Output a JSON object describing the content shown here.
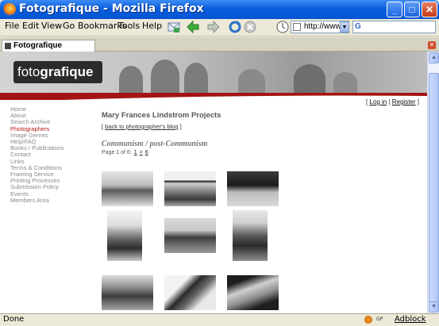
{
  "window": {
    "title": "Fotografique - Mozilla Firefox"
  },
  "menu": [
    "File",
    "Edit",
    "View",
    "Go",
    "Bookmarks",
    "Tools",
    "Help"
  ],
  "toolbar": {
    "url": "http://www"
  },
  "tab": {
    "label": "Fotografique"
  },
  "site": {
    "logo_light": "foto",
    "logo_bold": "grafique",
    "login": "Log in",
    "register": "Register",
    "nav": [
      "Home",
      "About",
      "Search Archive",
      "Photographers",
      "Image Genres",
      "Help/FAQ",
      "Books / Publications",
      "Contact",
      "Links",
      "Terms & Conditions",
      "Framing Service",
      "Printing Processes",
      "Submission Policy",
      "Events",
      "Members Area"
    ],
    "active_nav": "Photographers",
    "accent_color": "#b51a1a"
  },
  "main": {
    "title": "Mary Frances Lindstrom Projects",
    "back_link": "back to photographer's blog",
    "project": "Communism / post-Communism",
    "page_label": "Page 1 of 6:",
    "pager": [
      "1",
      ">",
      "6"
    ]
  },
  "status": {
    "text": "Done",
    "gp": "GP",
    "adblock": "Adblock"
  }
}
